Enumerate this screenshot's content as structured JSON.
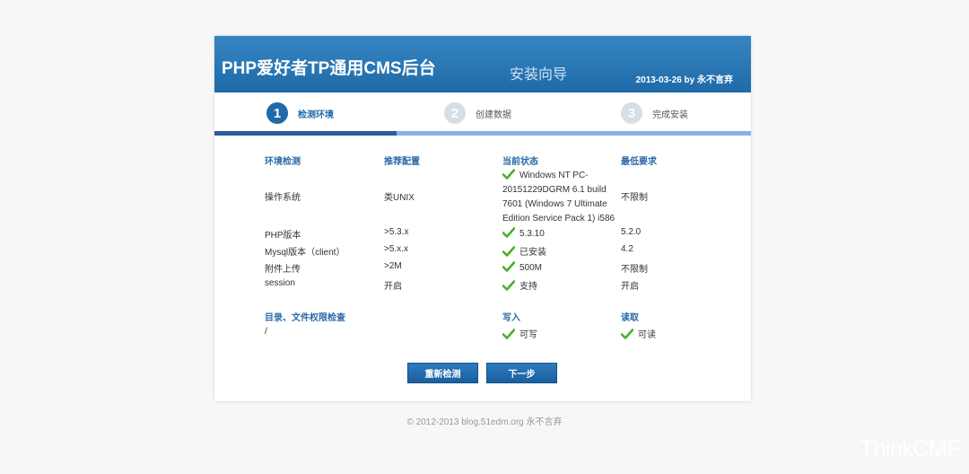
{
  "header": {
    "title": "PHP爱好者TP通用CMS后台",
    "subtitle": "安装向导",
    "date": "2013-03-26 by 永不言弃"
  },
  "steps": [
    {
      "number": "1",
      "label": "检测环境",
      "active": true
    },
    {
      "number": "2",
      "label": "创建数据",
      "active": false
    },
    {
      "number": "3",
      "label": "完成安装",
      "active": false
    }
  ],
  "env": {
    "headers": [
      "环境检测",
      "推荐配置",
      "当前状态",
      "最低要求"
    ],
    "rows": [
      {
        "name": "操作系统",
        "recommended": "类UNIX",
        "status": "Windows NT PC-20151229DGRM 6.1 build 7601 (Windows 7 Ultimate Edition Service Pack 1) i586",
        "min": "不限制"
      },
      {
        "name": "PHP版本",
        "recommended": ">5.3.x",
        "status": "5.3.10",
        "min": "5.2.0"
      },
      {
        "name": "Mysql版本（client）",
        "recommended": ">5.x.x",
        "status": "已安装",
        "min": "4.2"
      },
      {
        "name": "附件上传",
        "recommended": ">2M",
        "status": "500M",
        "min": "不限制"
      },
      {
        "name": "session",
        "recommended": "开启",
        "status": "支持",
        "min": "开启"
      }
    ]
  },
  "perm": {
    "headers": [
      "目录、文件权限检查",
      "写入",
      "读取"
    ],
    "rows": [
      {
        "path": "/",
        "write": "可写",
        "read": "可读"
      }
    ]
  },
  "buttons": {
    "recheck": "重新检测",
    "next": "下一步"
  },
  "footer": "© 2012-2013 blog.51edm.org 永不言弃",
  "watermark": "ThinkCMF",
  "progress": 0.34,
  "icons": {
    "check": "check-icon"
  },
  "colors": {
    "primary": "#1f6aa8",
    "check": "#4caf2a"
  }
}
